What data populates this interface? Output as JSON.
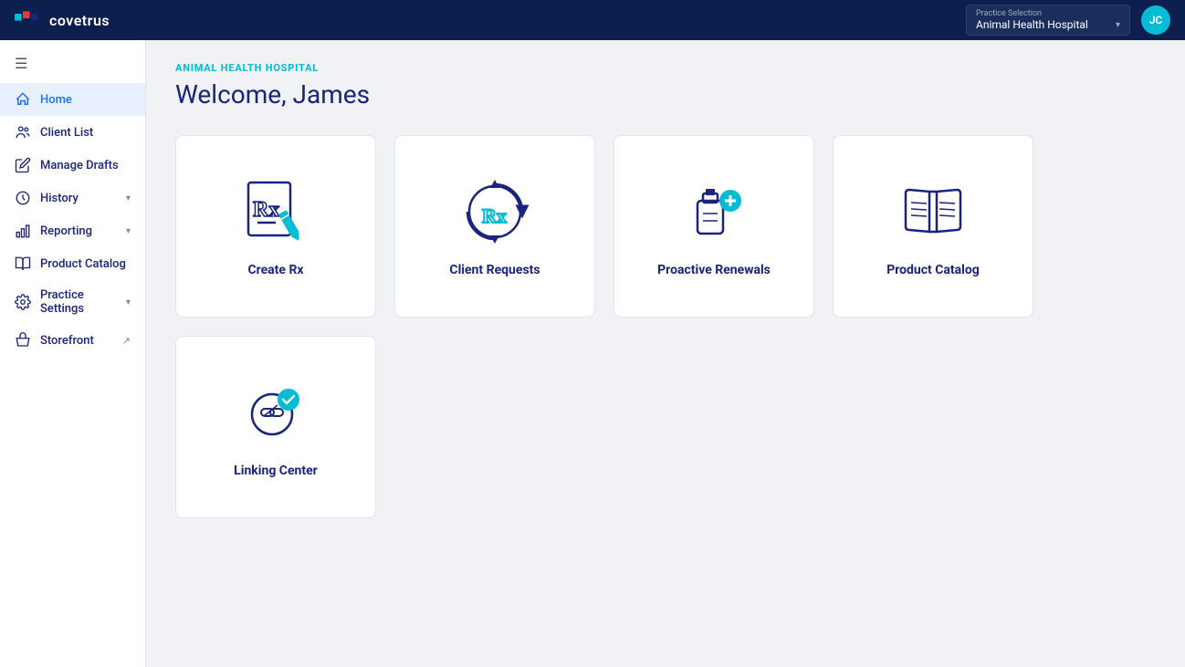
{
  "topnav": {
    "logo_text": "covetrus",
    "practice_selection_label": "Practice Selection",
    "practice_selection_value": "Animal Health Hospital",
    "avatar_initials": "JC"
  },
  "sidebar": {
    "hamburger_icon": "☰",
    "items": [
      {
        "id": "home",
        "label": "Home",
        "icon": "home",
        "active": true,
        "has_chevron": false
      },
      {
        "id": "client-list",
        "label": "Client List",
        "icon": "people",
        "active": false,
        "has_chevron": false
      },
      {
        "id": "manage-drafts",
        "label": "Manage Drafts",
        "icon": "edit",
        "active": false,
        "has_chevron": false
      },
      {
        "id": "history",
        "label": "History",
        "icon": "clock",
        "active": false,
        "has_chevron": true
      },
      {
        "id": "reporting",
        "label": "Reporting",
        "icon": "chart",
        "active": false,
        "has_chevron": true
      },
      {
        "id": "product-catalog",
        "label": "Product Catalog",
        "icon": "book",
        "active": false,
        "has_chevron": false
      },
      {
        "id": "practice-settings",
        "label": "Practice Settings",
        "icon": "gear",
        "active": false,
        "has_chevron": true
      },
      {
        "id": "storefront",
        "label": "Storefront",
        "icon": "store",
        "active": false,
        "has_chevron": false,
        "external": true
      }
    ]
  },
  "main": {
    "hospital_name": "ANIMAL HEALTH HOSPITAL",
    "welcome_message": "Welcome, James",
    "cards": [
      {
        "id": "create-rx",
        "label": "Create Rx"
      },
      {
        "id": "client-requests",
        "label": "Client Requests"
      },
      {
        "id": "proactive-renewals",
        "label": "Proactive Renewals"
      },
      {
        "id": "product-catalog",
        "label": "Product Catalog"
      }
    ],
    "cards_row2": [
      {
        "id": "linking-center",
        "label": "Linking Center"
      }
    ]
  }
}
